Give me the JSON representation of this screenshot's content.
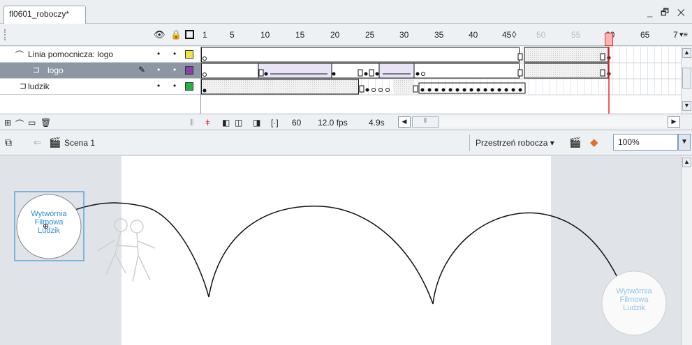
{
  "document": {
    "tab_title": "fl0601_roboczy*",
    "window_controls": [
      "_",
      "🗗",
      "✕"
    ]
  },
  "timeline": {
    "frame_numbers": [
      "1",
      "5",
      "10",
      "15",
      "20",
      "25",
      "30",
      "35",
      "40",
      "45",
      "50",
      "55",
      "60",
      "65",
      "7"
    ],
    "playhead_frame": "60",
    "layers": [
      {
        "name": "Linia pomocnicza: logo",
        "color": "#f2e24a",
        "icon": "guide-layer-icon"
      },
      {
        "name": "logo",
        "color": "#8c3fa6",
        "icon": "guided-layer-icon",
        "selected": true
      },
      {
        "name": "ludzik",
        "color": "#22b34a",
        "icon": "layer-icon"
      }
    ],
    "dot": "•",
    "footer": {
      "current_frame": "60",
      "fps": "12.0 fps",
      "time": "4.9s"
    }
  },
  "editbar": {
    "scene_label": "Scena 1",
    "workspace_label": "Przestrzeń robocza ▾",
    "zoom_value": "100%"
  },
  "stage": {
    "logo_line1": "Wytwórnia",
    "logo_line2": "Filmowa",
    "logo_line3": "Ludzik"
  },
  "colors": {
    "selected_layer": "#8d96a3",
    "playhead": "#ff2020",
    "selection_box": "#3399dd",
    "logo_text": "#2c8fd6"
  }
}
